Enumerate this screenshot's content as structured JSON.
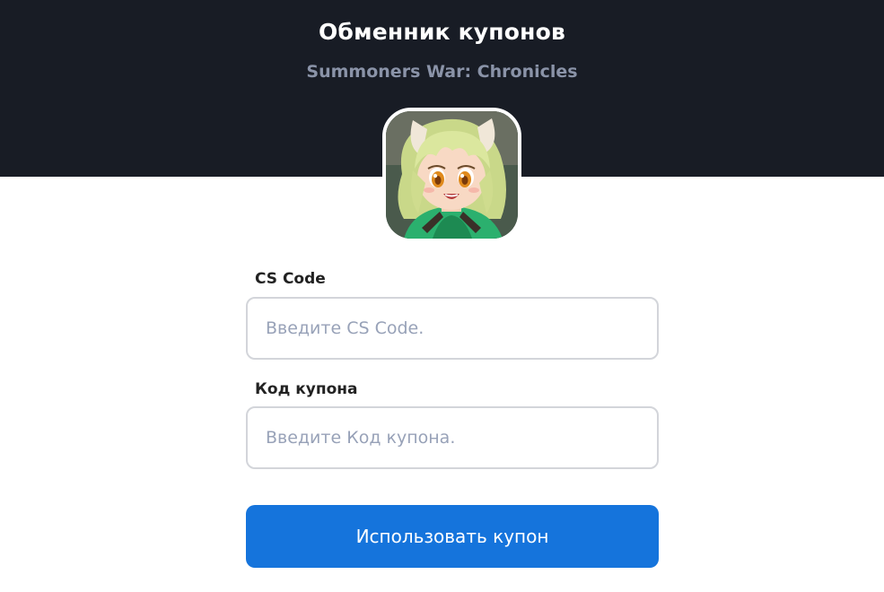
{
  "header": {
    "title": "Обменник купонов",
    "subtitle": "Summoners War: Chronicles"
  },
  "game_icon": {
    "icon": "game-character-portrait",
    "colors": {
      "hair": "#d9e59a",
      "eyes": "#e08a1c",
      "outfit": "#2bb06e",
      "background": "#3a4a3f"
    }
  },
  "form": {
    "cs_code": {
      "label": "CS Code",
      "placeholder": "Введите CS Code.",
      "value": ""
    },
    "coupon_code": {
      "label": "Код купона",
      "placeholder": "Введите Код купона.",
      "value": ""
    },
    "submit_label": "Использовать купон"
  },
  "colors": {
    "header_background": "#181c25",
    "accent": "#1574dc",
    "subtitle": "#8a93a8"
  }
}
